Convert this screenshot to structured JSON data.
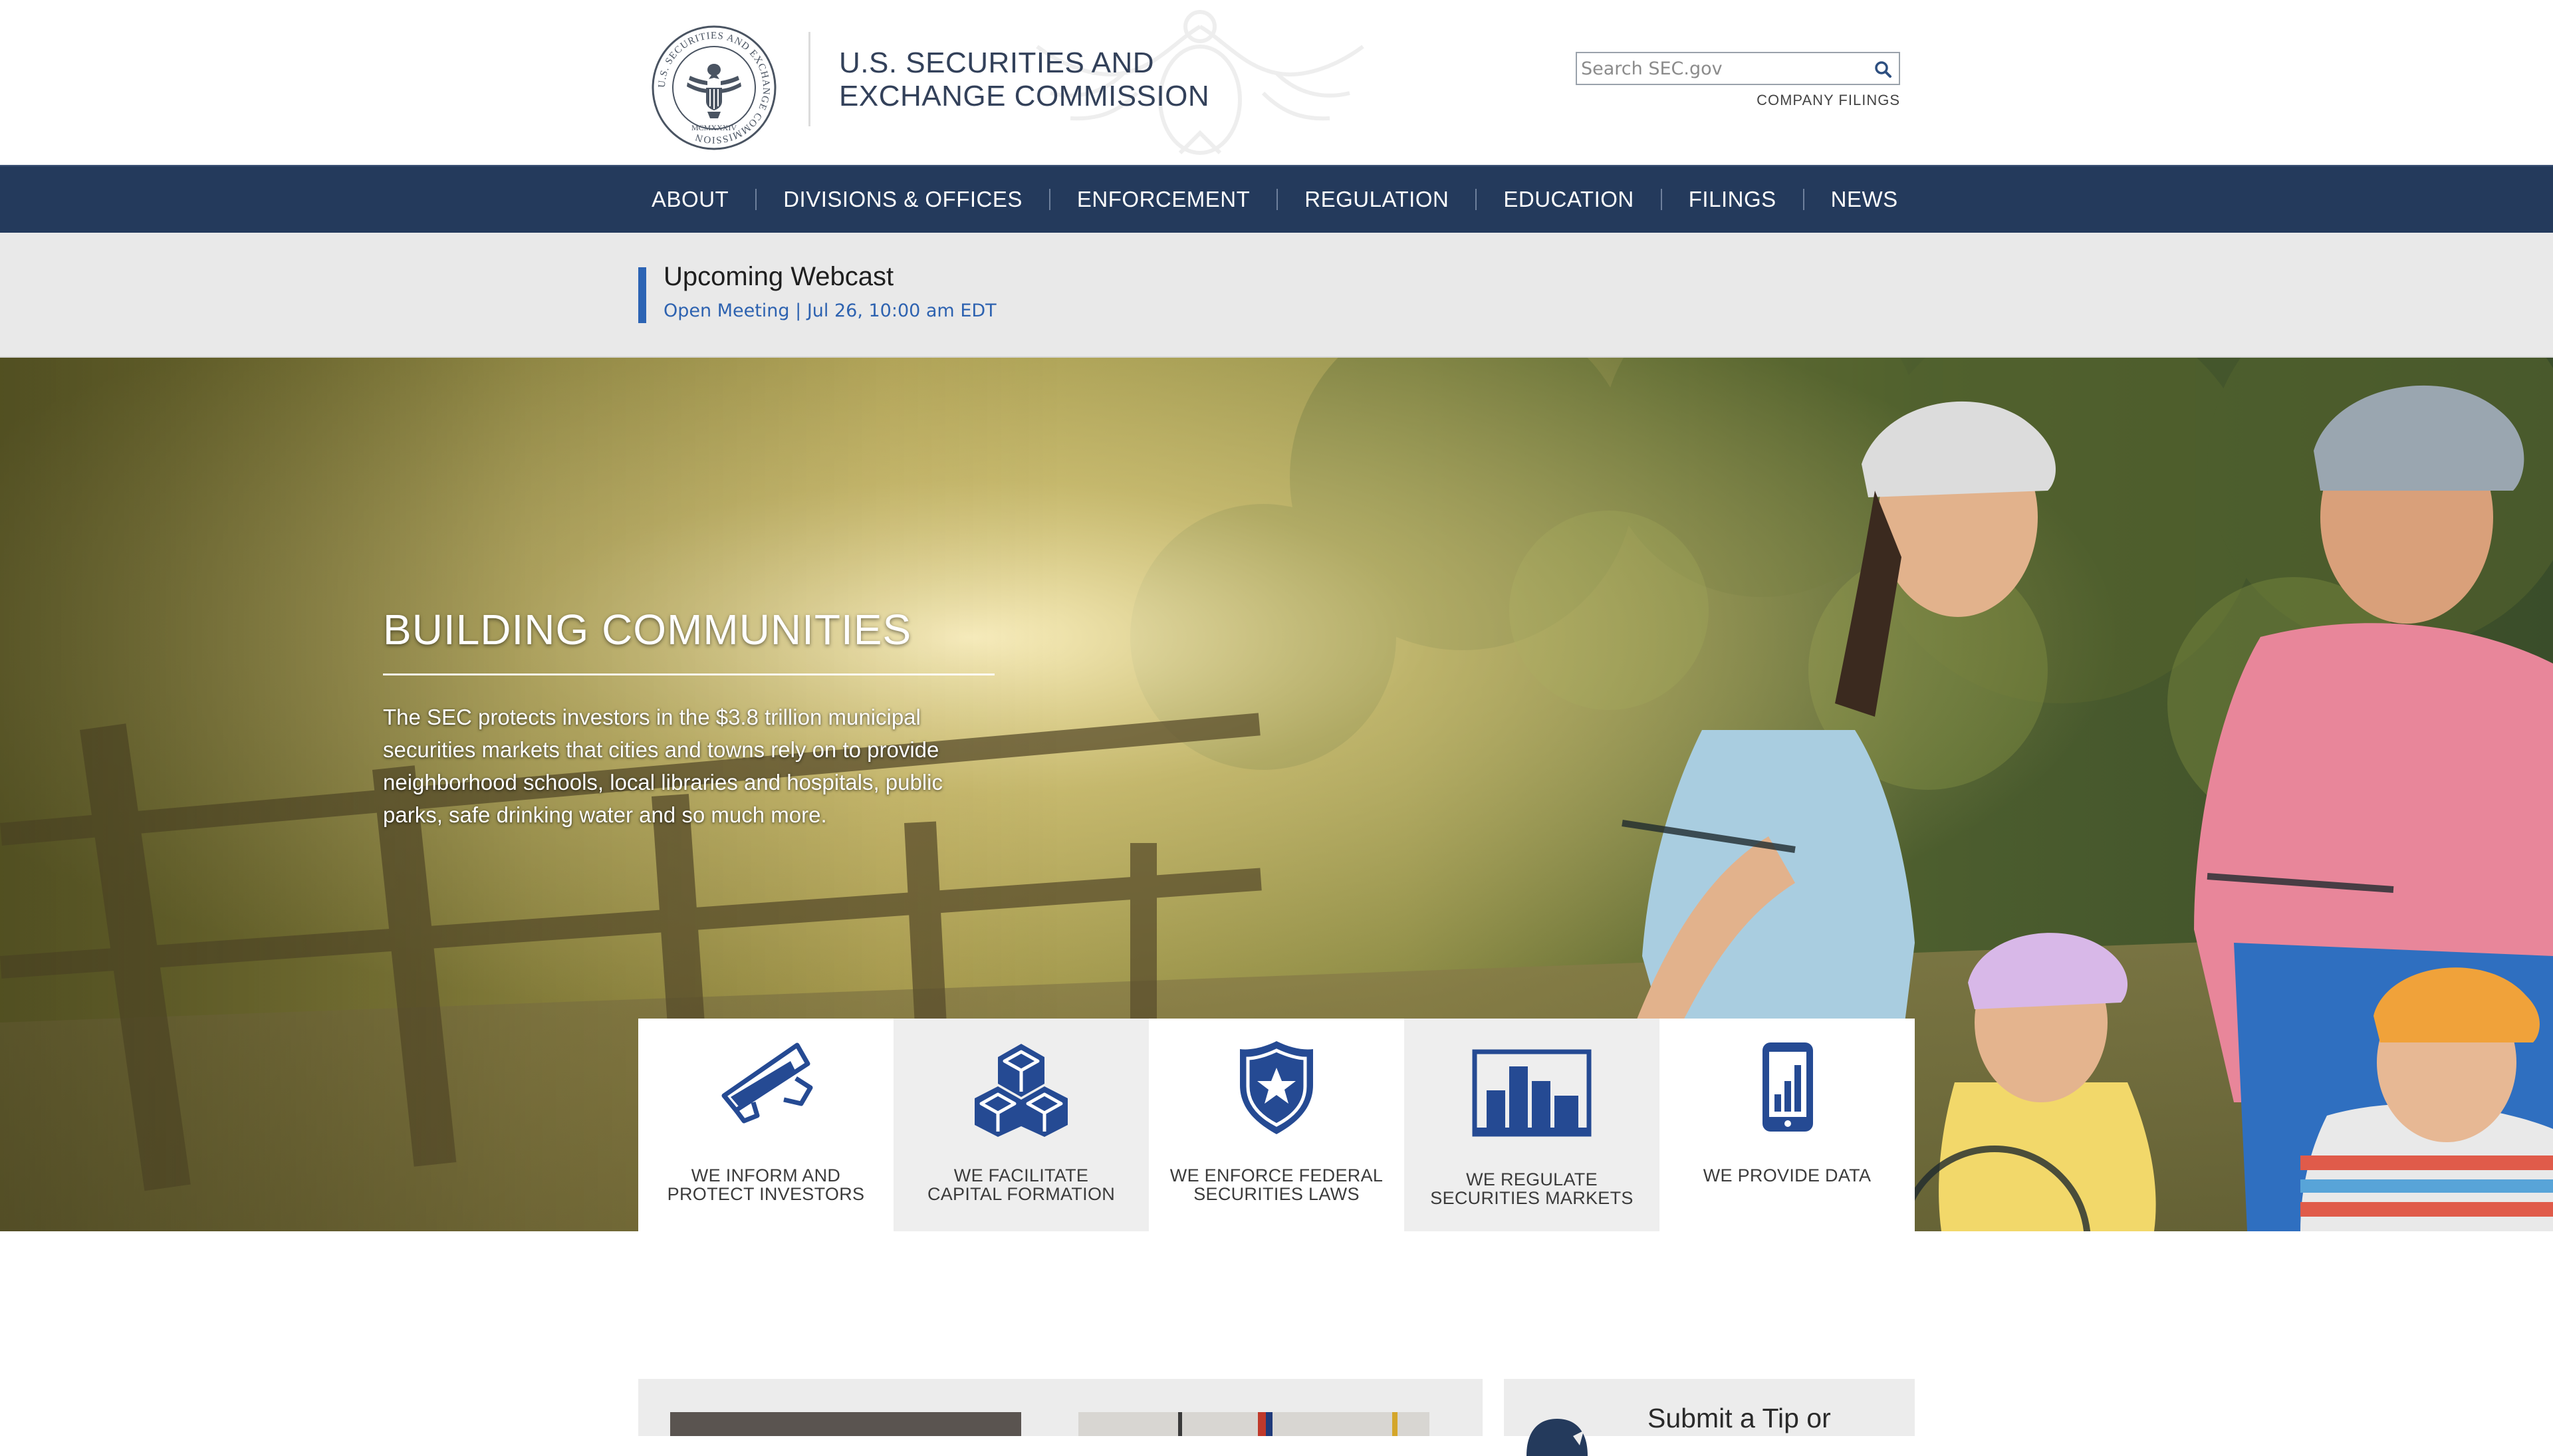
{
  "header": {
    "agency_name_line1": "U.S. SECURITIES AND",
    "agency_name_line2": "EXCHANGE COMMISSION",
    "seal_ring_text": "U.S. SECURITIES AND EXCHANGE COMMISSION",
    "seal_year": "MCMXXXIV",
    "search_placeholder": "Search SEC.gov",
    "company_filings_link": "COMPANY FILINGS"
  },
  "nav": {
    "items": [
      {
        "label": "ABOUT"
      },
      {
        "label": "DIVISIONS & OFFICES"
      },
      {
        "label": "ENFORCEMENT"
      },
      {
        "label": "REGULATION"
      },
      {
        "label": "EDUCATION"
      },
      {
        "label": "FILINGS"
      },
      {
        "label": "NEWS"
      }
    ]
  },
  "webcast": {
    "title": "Upcoming Webcast",
    "link": "Open Meeting | Jul 26, 10:00 am EDT"
  },
  "hero": {
    "title": "BUILDING COMMUNITIES",
    "text": "The SEC protects investors in the $3.8 trillion municipal securities markets that cities and towns rely on to provide neighborhood schools, local libraries and hospitals, public parks, safe drinking water and so much more."
  },
  "tiles": [
    {
      "line1": "WE INFORM AND",
      "line2": "PROTECT INVESTORS",
      "icon": "megaphone-icon"
    },
    {
      "line1": "WE FACILITATE",
      "line2": "CAPITAL FORMATION",
      "icon": "cubes-icon"
    },
    {
      "line1": "WE ENFORCE FEDERAL",
      "line2": "SECURITIES LAWS",
      "icon": "shield-star-icon"
    },
    {
      "line1": "WE REGULATE",
      "line2": "SECURITIES MARKETS",
      "icon": "bar-chart-icon"
    },
    {
      "line1": "WE PROVIDE DATA",
      "line2": "",
      "icon": "tablet-chart-icon"
    }
  ],
  "lower": {
    "tip_title": "Submit a Tip or"
  },
  "colors": {
    "nav_bg": "#243a5c",
    "accent_blue": "#2c64b4",
    "icon_blue": "#254a93",
    "webcast_bg": "#e9e9e9"
  }
}
